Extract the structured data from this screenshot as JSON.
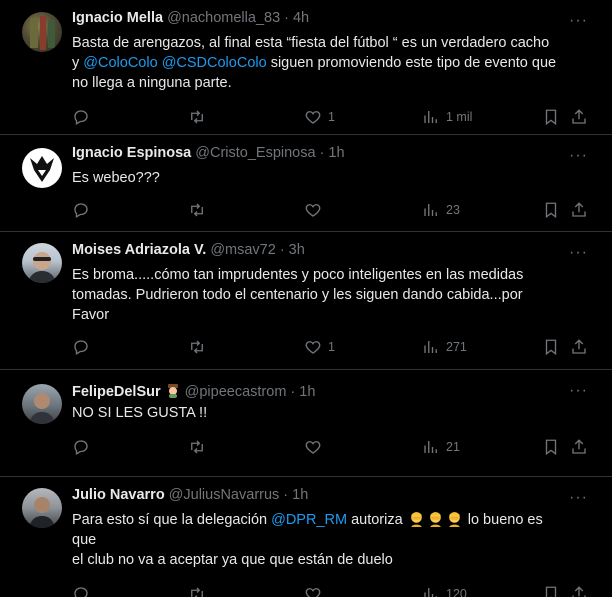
{
  "tweets": [
    {
      "name": "Ignacio Mella",
      "handle": "@nachomella_83",
      "sep": "·",
      "time": "4h",
      "text_lines": [
        [
          {
            "t": "Basta de arengazos, al final esta “fiesta del fútbol “ es un verdadero cacho"
          }
        ],
        [
          {
            "t": "y "
          },
          {
            "t": "@ColoColo",
            "m": true
          },
          {
            "t": " "
          },
          {
            "t": "@CSDColoColo",
            "m": true
          },
          {
            "t": " siguen promoviendo este tipo de evento que"
          }
        ],
        [
          {
            "t": "no llega a ninguna parte."
          }
        ]
      ],
      "likes": "1",
      "views": "1 mil"
    },
    {
      "name": "Ignacio Espinosa",
      "handle": "@Cristo_Espinosa",
      "sep": "·",
      "time": "1h",
      "text_lines": [
        [
          {
            "t": "Es webeo???"
          }
        ]
      ],
      "likes": "",
      "views": "23"
    },
    {
      "name": "Moises Adriazola V.",
      "handle": "@msav72",
      "sep": "·",
      "time": "3h",
      "text_lines": [
        [
          {
            "t": "Es broma.....cómo tan imprudentes y poco inteligentes en las medidas"
          }
        ],
        [
          {
            "t": "tomadas. Pudrieron todo el centenario y les siguen dando cabida...por"
          }
        ],
        [
          {
            "t": "Favor"
          }
        ]
      ],
      "likes": "1",
      "views": "271"
    },
    {
      "name": "FelipeDelSur",
      "handle": "@pipeecastrom",
      "sep": "·",
      "time": "1h",
      "text_lines": [
        [
          {
            "t": "NO SI LES GUSTA !!"
          }
        ]
      ],
      "likes": "",
      "views": "21"
    },
    {
      "name": "Julio Navarro",
      "handle": "@JuliusNavarrus",
      "sep": "·",
      "time": "1h",
      "text_lines": [
        [
          {
            "t": "Para esto sí que la delegación "
          },
          {
            "t": "@DPR_RM",
            "m": true
          },
          {
            "t": " autoriza "
          },
          {
            "e": 3
          },
          {
            "t": " lo bueno es que"
          }
        ],
        [
          {
            "t": "el club no va a aceptar ya que que están de duelo"
          }
        ]
      ],
      "likes": "",
      "views": "120"
    }
  ],
  "more_label": "···",
  "icons": [
    "reply-icon",
    "retweet-icon",
    "like-icon",
    "views-icon",
    "bookmark-icon",
    "share-icon"
  ],
  "colors": {
    "background": "#000000",
    "text": "#e7e9ea",
    "muted": "#71767b",
    "link": "#1d9bf0",
    "divider": "#2f3336"
  }
}
